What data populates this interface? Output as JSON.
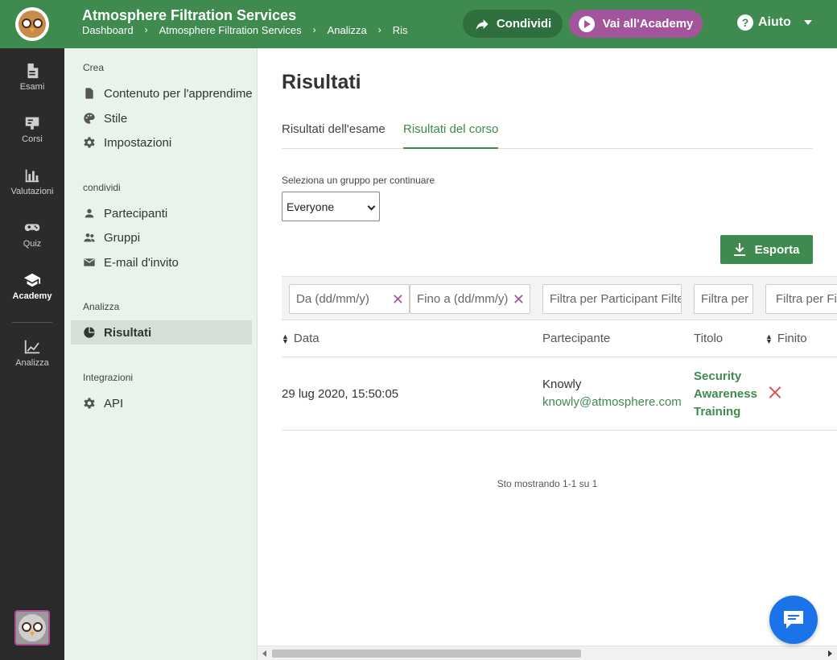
{
  "colors": {
    "brand_green": "#3f8a4f",
    "academy_purple": "#a3559c",
    "rail_bg": "#2b2b2b",
    "sidebar_bg": "#e8f3ea",
    "error_red": "#d9534f",
    "chat_blue": "#1a73e8"
  },
  "header": {
    "title": "Atmosphere Filtration Services",
    "breadcrumbs": [
      "Dashboard",
      "Atmosphere Filtration Services",
      "Analizza",
      "Ris"
    ],
    "share_label": "Condividi",
    "academy_label": "Vai all'Academy",
    "help_label": "Aiuto"
  },
  "rail": {
    "items": [
      {
        "label": "Esami",
        "icon": "document-icon"
      },
      {
        "label": "Corsi",
        "icon": "certificate-icon"
      },
      {
        "label": "Valutazioni",
        "icon": "bar-chart-icon"
      },
      {
        "label": "Quiz",
        "icon": "gamepad-icon"
      },
      {
        "label": "Academy",
        "icon": "graduation-cap-icon"
      },
      {
        "label": "Analizza",
        "icon": "line-chart-icon"
      }
    ]
  },
  "sidebar": {
    "sections": [
      {
        "heading": "Crea",
        "items": [
          "Contenuto per l'apprendimento",
          "Stile",
          "Impostazioni"
        ]
      },
      {
        "heading": "condividi",
        "items": [
          "Partecipanti",
          "Gruppi",
          "E-mail d'invito"
        ]
      },
      {
        "heading": "Analizza",
        "items": [
          "Risultati"
        ]
      },
      {
        "heading": "Integrazioni",
        "items": [
          "API"
        ]
      }
    ]
  },
  "main": {
    "title": "Risultati",
    "tabs": [
      "Risultati dell'esame",
      "Risultati del corso"
    ],
    "group_label": "Seleziona un gruppo per continuare",
    "group_selected": "Everyone",
    "export_label": "Esporta",
    "filters": {
      "from_placeholder": "Da (dd/mm/y)",
      "to_placeholder": "Fino a (dd/mm/y)",
      "participant_placeholder": "Filtra per Participant Filter",
      "title_placeholder": "Filtra per",
      "finished_placeholder": "Filtra per Finito"
    },
    "columns": [
      "Data",
      "Partecipante",
      "Titolo",
      "Finito"
    ],
    "rows": [
      {
        "date": "29 lug 2020, 15:50:05",
        "participant_name": "Knowly",
        "participant_email": "knowly@atmosphere.com",
        "title_lines": [
          "Security",
          "Awareness",
          "Training"
        ],
        "finished": false
      }
    ],
    "pager_text": "Sto mostrando 1-1 su 1"
  }
}
